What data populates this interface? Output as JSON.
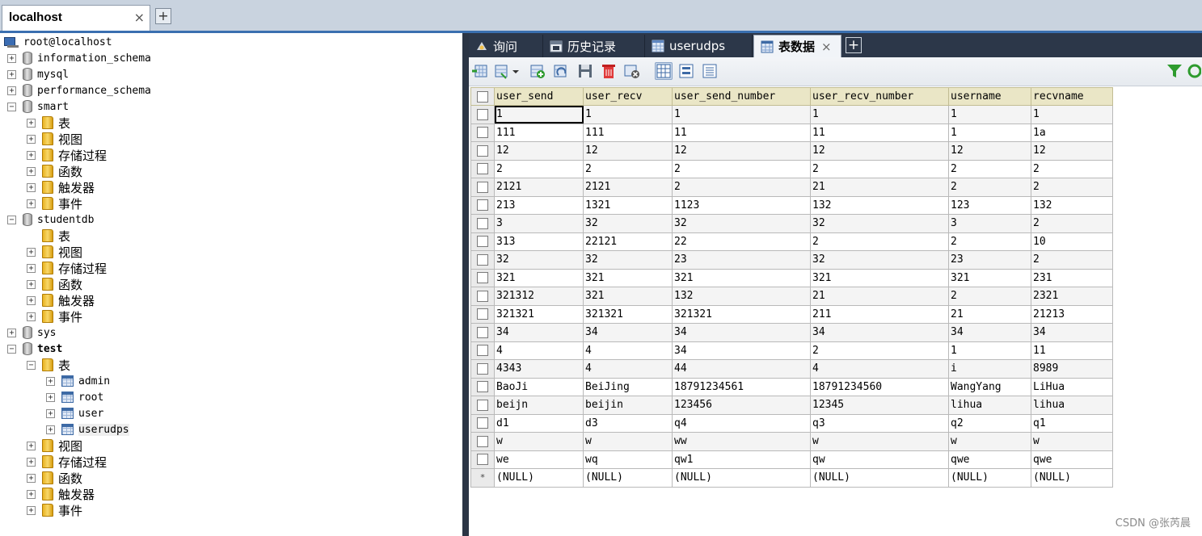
{
  "connection_tab": {
    "label": "localhost",
    "close": "×",
    "add": "+"
  },
  "tree": {
    "root": "root@localhost",
    "db_information_schema": "information_schema",
    "db_mysql": "mysql",
    "db_performance_schema": "performance_schema",
    "db_smart": "smart",
    "smart_tables": "表",
    "smart_views": "视图",
    "smart_procs": "存储过程",
    "smart_funcs": "函数",
    "smart_triggers": "触发器",
    "smart_events": "事件",
    "db_studentdb": "studentdb",
    "studentdb_tables": "表",
    "studentdb_views": "视图",
    "studentdb_procs": "存储过程",
    "studentdb_funcs": "函数",
    "studentdb_triggers": "触发器",
    "studentdb_events": "事件",
    "db_sys": "sys",
    "db_test": "test",
    "test_tables": "表",
    "table_admin": "admin",
    "table_root": "root",
    "table_user": "user",
    "table_userudps": "userudps",
    "test_views": "视图",
    "test_procs": "存储过程",
    "test_funcs": "函数",
    "test_triggers": "触发器",
    "test_events": "事件",
    "expand_symbol": "+",
    "collapse_symbol": "−"
  },
  "query_tabs": {
    "query": "询问",
    "history": "历史记录",
    "userudps": "userudps",
    "table_data": "表数据",
    "table_data_close": "×",
    "add": "+"
  },
  "toolbar_icons": [
    "insert-row-icon",
    "dropdown-export-icon",
    "add-row-icon",
    "refresh-icon",
    "save-icon",
    "delete-icon",
    "cancel-icon",
    "grid-view-icon",
    "form-view-icon",
    "text-view-icon",
    "filter-icon",
    "reload-icon"
  ],
  "grid": {
    "columns": [
      "user_send",
      "user_recv",
      "user_send_number",
      "user_recv_number",
      "username",
      "recvname"
    ],
    "rows": [
      [
        "1",
        "1",
        "1",
        "1",
        "1",
        "1"
      ],
      [
        "111",
        "111",
        "11",
        "11",
        "1",
        "1a"
      ],
      [
        "12",
        "12",
        "12",
        "12",
        "12",
        "12"
      ],
      [
        "2",
        "2",
        "2",
        "2",
        "2",
        "2"
      ],
      [
        "2121",
        "2121",
        "2",
        "21",
        "2",
        "2"
      ],
      [
        "213",
        "1321",
        "1123",
        "132",
        "123",
        "132"
      ],
      [
        "3",
        "32",
        "32",
        "32",
        "3",
        "2"
      ],
      [
        "313",
        "22121",
        "22",
        "2",
        "2",
        "10"
      ],
      [
        "32",
        "32",
        "23",
        "32",
        "23",
        "2"
      ],
      [
        "321",
        "321",
        "321",
        "321",
        "321",
        "231"
      ],
      [
        "321312",
        "321",
        "132",
        "21",
        "2",
        "2321"
      ],
      [
        "321321",
        "321321",
        "321321",
        "211",
        "21",
        "21213"
      ],
      [
        "34",
        "34",
        "34",
        "34",
        "34",
        "34"
      ],
      [
        "4",
        "4",
        "34",
        "2",
        "1",
        "11"
      ],
      [
        "4343",
        "4",
        "44",
        "4",
        "i",
        "8989"
      ],
      [
        "BaoJi",
        "BeiJing",
        "18791234561",
        "18791234560",
        "WangYang",
        "LiHua"
      ],
      [
        "beijn",
        "beijin",
        "123456",
        "12345",
        "lihua",
        "lihua"
      ],
      [
        "d1",
        "d3",
        "q4",
        "q3",
        "q2",
        "q1"
      ],
      [
        "w",
        "w",
        "ww",
        "w",
        "w",
        "w"
      ],
      [
        "we",
        "wq",
        "qw1",
        "qw",
        "qwe",
        "qwe"
      ]
    ],
    "new_row_marker": "*",
    "null_value": "(NULL)"
  },
  "colors": {
    "header_bg": "#eae6c6",
    "tab_bar_bg": "#2c3749",
    "connection_bar_bg": "#c9d3df",
    "accent_line": "#3a6fb0"
  },
  "watermark": "CSDN @张芮晨"
}
